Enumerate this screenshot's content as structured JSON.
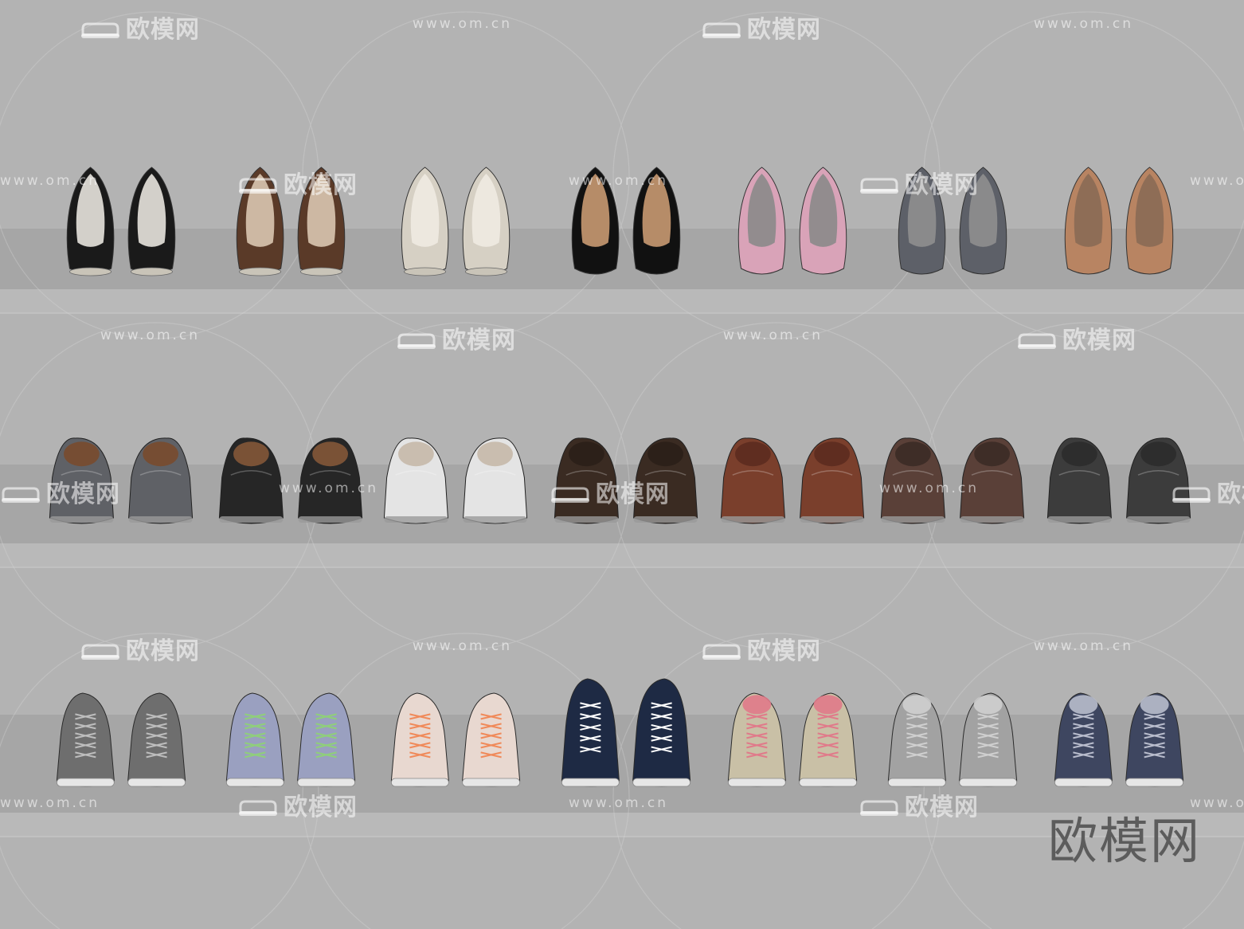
{
  "image": {
    "background": "#b3b3b3",
    "shelf_color": "#a7a7a7"
  },
  "watermarks": {
    "cn_text": "欧模网",
    "url_text": "www.om.cn"
  },
  "brand_mark": "欧模网",
  "rows": [
    {
      "type": "heels",
      "pairs": [
        {
          "name": "black-white-pattern-heels",
          "color": "#1a1a1a",
          "accent": "#e8e4de",
          "style": "heel"
        },
        {
          "name": "brown-pattern-heels",
          "color": "#5a3a28",
          "accent": "#d9c7b0",
          "style": "heel"
        },
        {
          "name": "cream-heels",
          "color": "#d6d0c4",
          "accent": "#efeae2",
          "style": "heel"
        },
        {
          "name": "black-suede-heels",
          "color": "#111111",
          "accent": "#c99a72",
          "style": "pump"
        },
        {
          "name": "pink-heels",
          "color": "#d9a3b8",
          "accent": "#8a8a8a",
          "style": "pump"
        },
        {
          "name": "grey-heels",
          "color": "#5d6068",
          "accent": "#8f8f8f",
          "style": "pump"
        },
        {
          "name": "tan-heels",
          "color": "#b88462",
          "accent": "#8a6a55",
          "style": "pump"
        }
      ]
    },
    {
      "type": "loafers",
      "pairs": [
        {
          "name": "grey-boat-shoes",
          "color": "#5f6166",
          "accent": "#7a4a2a",
          "style": "loafer"
        },
        {
          "name": "black-boat-shoes",
          "color": "#262626",
          "accent": "#8a5a3a",
          "style": "loafer"
        },
        {
          "name": "white-boat-shoes",
          "color": "#e4e4e4",
          "accent": "#c4b6a6",
          "style": "loafer"
        },
        {
          "name": "dark-brown-loafers",
          "color": "#3a2b22",
          "accent": "#2a1e18",
          "style": "loafer"
        },
        {
          "name": "brown-loafers",
          "color": "#7a3f2c",
          "accent": "#5a2a1e",
          "style": "loafer"
        },
        {
          "name": "suede-brown-loafers",
          "color": "#5a4038",
          "accent": "#3a2a24",
          "style": "loafer"
        },
        {
          "name": "charcoal-loafers",
          "color": "#3c3c3c",
          "accent": "#2a2a2a",
          "style": "loafer"
        }
      ]
    },
    {
      "type": "sneakers",
      "pairs": [
        {
          "name": "grey-sneakers",
          "color": "#6e6e6e",
          "accent": "#bdbdbd",
          "style": "sneaker"
        },
        {
          "name": "lilac-sneakers",
          "color": "#9aa0c0",
          "accent": "#8fcf7a",
          "style": "sneaker"
        },
        {
          "name": "pink-white-sneakers",
          "color": "#e8d8d0",
          "accent": "#f08a5a",
          "style": "sneaker"
        },
        {
          "name": "navy-high-tops",
          "color": "#1e2a44",
          "accent": "#ffffff",
          "style": "hightop"
        },
        {
          "name": "beige-deck-shoes",
          "color": "#c9c0a6",
          "accent": "#e07a8a",
          "style": "deck"
        },
        {
          "name": "grey-deck-shoes",
          "color": "#a2a2a2",
          "accent": "#cfcfcf",
          "style": "deck"
        },
        {
          "name": "denim-deck-shoes",
          "color": "#3e4660",
          "accent": "#b8bccc",
          "style": "deck"
        }
      ]
    }
  ]
}
